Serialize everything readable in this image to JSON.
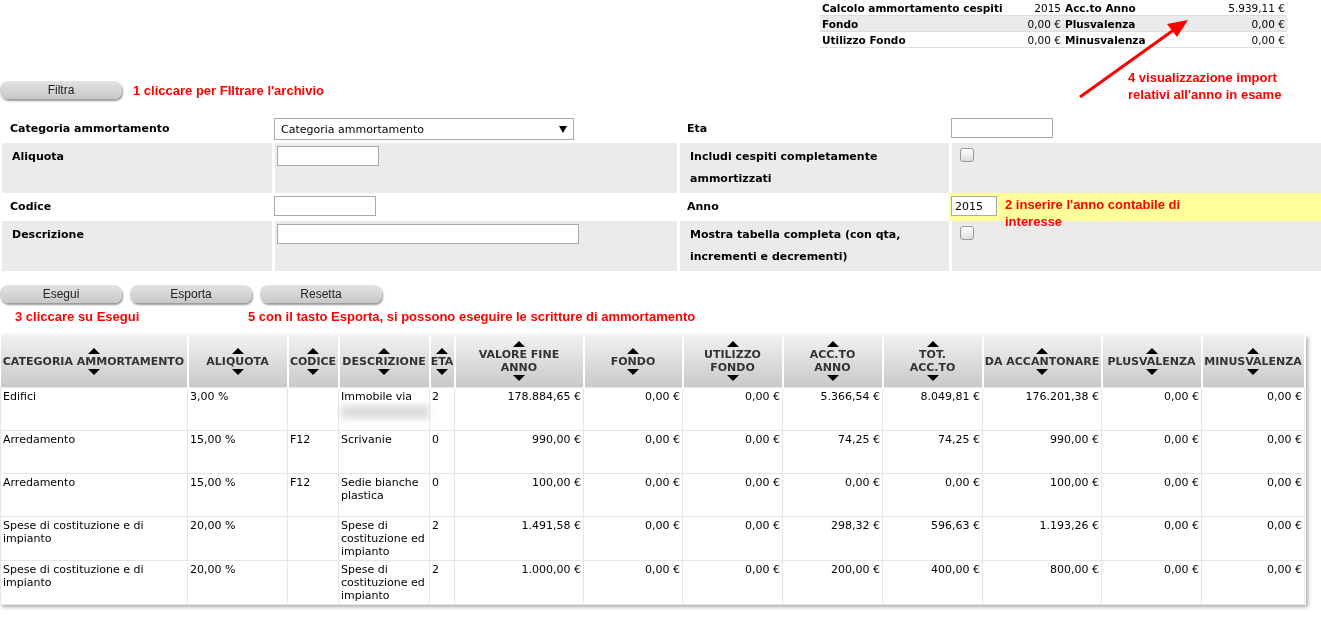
{
  "summary": {
    "rows": [
      {
        "left_label": "Calcolo ammortamento cespiti",
        "left_value": "2015",
        "right_label": "Acc.to Anno",
        "right_value": "5.939,11 €"
      },
      {
        "left_label": "Fondo",
        "left_value": "0,00 €",
        "right_label": "Plusvalenza",
        "right_value": "0,00 €"
      },
      {
        "left_label": "Utilizzo Fondo",
        "left_value": "0,00 €",
        "right_label": "Minusvalenza",
        "right_value": "0,00 €"
      }
    ]
  },
  "summary_note": "4 visualizzazione import relativi all'anno in esame",
  "filter_button": "Filtra",
  "filter_note": "1 cliccare per FIltrare l'archivio",
  "form": {
    "rows": [
      {
        "highlighted": false,
        "fields": [
          {
            "label": "Categoria ammortamento",
            "kind": "select",
            "value": "Categoria ammortamento"
          },
          {
            "label": "Eta",
            "kind": "text"
          }
        ]
      },
      {
        "highlighted": false,
        "fields": [
          {
            "label": "Aliquota",
            "kind": "text"
          },
          {
            "label": "Includi cespiti completamente ammortizzati",
            "kind": "checkbox",
            "checked": false
          }
        ]
      },
      {
        "highlighted": true,
        "note": "2 inserire l'anno contabile di interesse",
        "fields": [
          {
            "label": "Codice",
            "kind": "text"
          },
          {
            "label": "Anno",
            "kind": "text",
            "value": "2015"
          }
        ]
      },
      {
        "highlighted": false,
        "fields": [
          {
            "label": "Descrizione",
            "kind": "text"
          },
          {
            "label": "Mostra tabella completa (con qta, incrementi e decrementi)",
            "kind": "checkbox",
            "checked": false
          }
        ]
      }
    ]
  },
  "buttons": [
    "Esegui",
    "Esporta",
    "Resetta"
  ],
  "button_notes": [
    "3 cliccare su Esegui",
    "5 con il tasto Esporta, si possono eseguire le scritture di ammortamento"
  ],
  "table": {
    "columns": [
      "CATEGORIA AMMORTAMENTO",
      "ALIQUOTA",
      "CODICE",
      "DESCRIZIONE",
      "ETA",
      "VALORE FINE ANNO",
      "FONDO",
      "UTILIZZO FONDO",
      "ACC.TO ANNO",
      "TOT. ACC.TO",
      "DA ACCANTONARE",
      "PLUSVALENZA",
      "MINUSVALENZA"
    ],
    "rows": [
      {
        "blurred": true,
        "cells": [
          "Edifici",
          "3,00 %",
          "",
          "Immobile via",
          "2",
          "178.884,65 €",
          "0,00 €",
          "0,00 €",
          "5.366,54 €",
          "8.049,81 €",
          "176.201,38 €",
          "0,00 €",
          "0,00 €"
        ]
      },
      {
        "blurred": false,
        "cells": [
          "Arredamento",
          "15,00 %",
          "F12",
          "Scrivanie",
          "0",
          "990,00 €",
          "0,00 €",
          "0,00 €",
          "74,25 €",
          "74,25 €",
          "990,00 €",
          "0,00 €",
          "0,00 €"
        ]
      },
      {
        "blurred": false,
        "cells": [
          "Arredamento",
          "15,00 %",
          "F12",
          "Sedie bianche plastica",
          "0",
          "100,00 €",
          "0,00 €",
          "0,00 €",
          "0,00 €",
          "0,00 €",
          "100,00 €",
          "0,00 €",
          "0,00 €"
        ]
      },
      {
        "blurred": false,
        "cells": [
          "Spese di costituzione e di impianto",
          "20,00 %",
          "",
          "Spese di costituzione ed impianto",
          "2",
          "1.491,58 €",
          "0,00 €",
          "0,00 €",
          "298,32 €",
          "596,63 €",
          "1.193,26 €",
          "0,00 €",
          "0,00 €"
        ]
      },
      {
        "blurred": false,
        "cells": [
          "Spese di costituzione e di impianto",
          "20,00 %",
          "",
          "Spese di costituzione ed impianto",
          "2",
          "1.000,00 €",
          "0,00 €",
          "0,00 €",
          "200,00 €",
          "400,00 €",
          "800,00 €",
          "0,00 €",
          "0,00 €"
        ]
      }
    ]
  }
}
